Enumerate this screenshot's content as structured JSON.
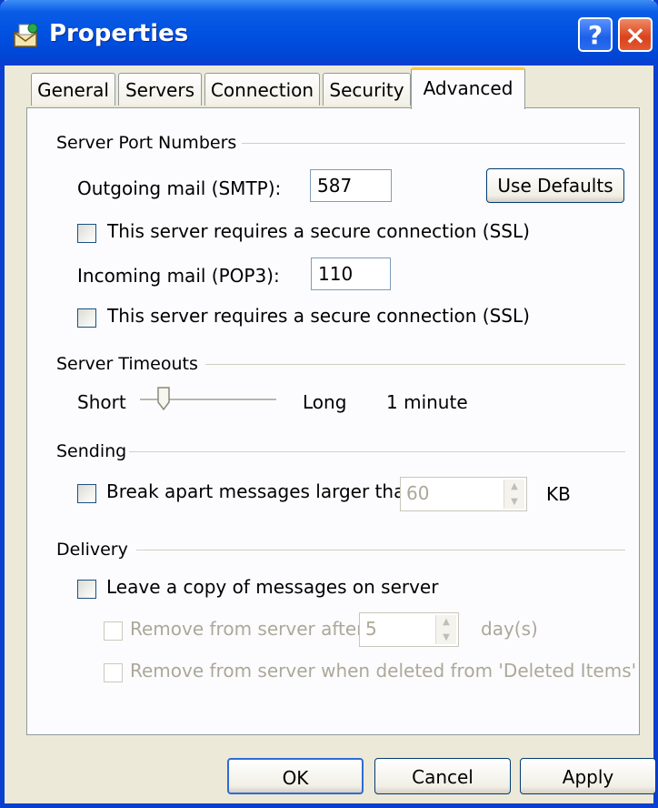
{
  "window": {
    "title": "Properties",
    "help_glyph": "?",
    "close_glyph": "×"
  },
  "tabs": [
    {
      "label": "General",
      "active": false
    },
    {
      "label": "Servers",
      "active": false
    },
    {
      "label": "Connection",
      "active": false
    },
    {
      "label": "Security",
      "active": false
    },
    {
      "label": "Advanced",
      "active": true
    }
  ],
  "server_ports": {
    "title": "Server Port Numbers",
    "outgoing_label": "Outgoing mail (SMTP):",
    "outgoing_value": "587",
    "use_defaults_label": "Use Defaults",
    "outgoing_ssl_label": "This server requires a secure connection (SSL)",
    "outgoing_ssl_checked": false,
    "incoming_label": "Incoming mail (POP3):",
    "incoming_value": "110",
    "incoming_ssl_label": "This server requires a secure connection (SSL)",
    "incoming_ssl_checked": false
  },
  "timeouts": {
    "title": "Server Timeouts",
    "short_label": "Short",
    "long_label": "Long",
    "value_label": "1 minute",
    "slider_level": 0.17
  },
  "sending": {
    "title": "Sending",
    "break_apart_label": "Break apart messages larger than",
    "break_apart_checked": false,
    "size_value": "60",
    "unit_label": "KB"
  },
  "delivery": {
    "title": "Delivery",
    "leave_copy_label": "Leave a copy of messages on server",
    "leave_copy_checked": false,
    "remove_after_label": "Remove from server after",
    "remove_after_value": "5",
    "days_label": "day(s)",
    "remove_deleted_label": "Remove from server when deleted from 'Deleted Items'"
  },
  "buttons": {
    "ok": "OK",
    "cancel": "Cancel",
    "apply": "Apply"
  },
  "colors": {
    "titlebar": "#0a3fd0",
    "dialog_bg": "#ece9d8",
    "active_tab_accent": "#ffc83c"
  }
}
